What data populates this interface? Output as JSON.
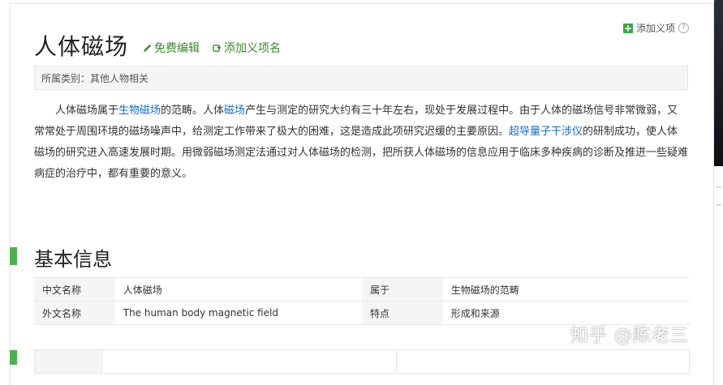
{
  "header": {
    "title": "人体磁场",
    "edit_label": "免费编辑",
    "add_name_label": "添加义项名",
    "add_meaning_label": "添加义项",
    "help_glyph": "?"
  },
  "category": {
    "text": "所属类别：其他人物相关"
  },
  "summary": {
    "p1_a": "人体磁场属于",
    "link1": "生物磁场",
    "p1_b": "的范畴。人体",
    "link2": "磁场",
    "p1_c": "产生与测定的研究大约有三十年左右，现处于发展过程中。由于人体的磁场信号非常微弱，又常常处于周围环境的磁场噪声中，给测定工作带来了极大的困难，这是造成此项研究迟缓的主要原因。",
    "link3": "超导量子干涉仪",
    "p1_d": "的研制成功，使人体磁场的研究进入高速发展时期。用微弱磁场测定法通过对人体磁场的检测，把所获人体磁场的信息应用于临床多种疾病的诊断及推进一些疑难病症的治疗中，都有重要的意义。"
  },
  "basic_info": {
    "section_title": "基本信息",
    "rows": [
      {
        "k1": "中文名称",
        "v1": "人体磁场",
        "k2": "属于",
        "v2": "生物磁场的范畴"
      },
      {
        "k1": "外文名称",
        "v1": "The human body magnetic field",
        "k2": "特点",
        "v2": "形成和来源"
      }
    ]
  },
  "watermark": "知乎 @陈老三",
  "colors": {
    "accent_green": "#3aa744",
    "link_blue": "#136ec2",
    "section_green": "#4cb34c"
  }
}
